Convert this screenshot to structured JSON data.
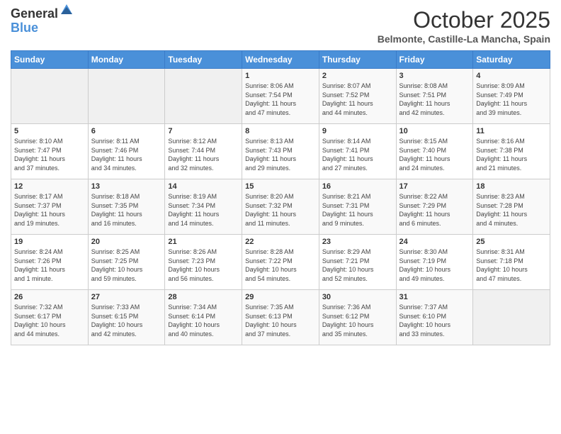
{
  "logo": {
    "general": "General",
    "blue": "Blue"
  },
  "title": "October 2025",
  "location": "Belmonte, Castille-La Mancha, Spain",
  "headers": [
    "Sunday",
    "Monday",
    "Tuesday",
    "Wednesday",
    "Thursday",
    "Friday",
    "Saturday"
  ],
  "weeks": [
    [
      {
        "day": "",
        "info": ""
      },
      {
        "day": "",
        "info": ""
      },
      {
        "day": "",
        "info": ""
      },
      {
        "day": "1",
        "info": "Sunrise: 8:06 AM\nSunset: 7:54 PM\nDaylight: 11 hours\nand 47 minutes."
      },
      {
        "day": "2",
        "info": "Sunrise: 8:07 AM\nSunset: 7:52 PM\nDaylight: 11 hours\nand 44 minutes."
      },
      {
        "day": "3",
        "info": "Sunrise: 8:08 AM\nSunset: 7:51 PM\nDaylight: 11 hours\nand 42 minutes."
      },
      {
        "day": "4",
        "info": "Sunrise: 8:09 AM\nSunset: 7:49 PM\nDaylight: 11 hours\nand 39 minutes."
      }
    ],
    [
      {
        "day": "5",
        "info": "Sunrise: 8:10 AM\nSunset: 7:47 PM\nDaylight: 11 hours\nand 37 minutes."
      },
      {
        "day": "6",
        "info": "Sunrise: 8:11 AM\nSunset: 7:46 PM\nDaylight: 11 hours\nand 34 minutes."
      },
      {
        "day": "7",
        "info": "Sunrise: 8:12 AM\nSunset: 7:44 PM\nDaylight: 11 hours\nand 32 minutes."
      },
      {
        "day": "8",
        "info": "Sunrise: 8:13 AM\nSunset: 7:43 PM\nDaylight: 11 hours\nand 29 minutes."
      },
      {
        "day": "9",
        "info": "Sunrise: 8:14 AM\nSunset: 7:41 PM\nDaylight: 11 hours\nand 27 minutes."
      },
      {
        "day": "10",
        "info": "Sunrise: 8:15 AM\nSunset: 7:40 PM\nDaylight: 11 hours\nand 24 minutes."
      },
      {
        "day": "11",
        "info": "Sunrise: 8:16 AM\nSunset: 7:38 PM\nDaylight: 11 hours\nand 21 minutes."
      }
    ],
    [
      {
        "day": "12",
        "info": "Sunrise: 8:17 AM\nSunset: 7:37 PM\nDaylight: 11 hours\nand 19 minutes."
      },
      {
        "day": "13",
        "info": "Sunrise: 8:18 AM\nSunset: 7:35 PM\nDaylight: 11 hours\nand 16 minutes."
      },
      {
        "day": "14",
        "info": "Sunrise: 8:19 AM\nSunset: 7:34 PM\nDaylight: 11 hours\nand 14 minutes."
      },
      {
        "day": "15",
        "info": "Sunrise: 8:20 AM\nSunset: 7:32 PM\nDaylight: 11 hours\nand 11 minutes."
      },
      {
        "day": "16",
        "info": "Sunrise: 8:21 AM\nSunset: 7:31 PM\nDaylight: 11 hours\nand 9 minutes."
      },
      {
        "day": "17",
        "info": "Sunrise: 8:22 AM\nSunset: 7:29 PM\nDaylight: 11 hours\nand 6 minutes."
      },
      {
        "day": "18",
        "info": "Sunrise: 8:23 AM\nSunset: 7:28 PM\nDaylight: 11 hours\nand 4 minutes."
      }
    ],
    [
      {
        "day": "19",
        "info": "Sunrise: 8:24 AM\nSunset: 7:26 PM\nDaylight: 11 hours\nand 1 minute."
      },
      {
        "day": "20",
        "info": "Sunrise: 8:25 AM\nSunset: 7:25 PM\nDaylight: 10 hours\nand 59 minutes."
      },
      {
        "day": "21",
        "info": "Sunrise: 8:26 AM\nSunset: 7:23 PM\nDaylight: 10 hours\nand 56 minutes."
      },
      {
        "day": "22",
        "info": "Sunrise: 8:28 AM\nSunset: 7:22 PM\nDaylight: 10 hours\nand 54 minutes."
      },
      {
        "day": "23",
        "info": "Sunrise: 8:29 AM\nSunset: 7:21 PM\nDaylight: 10 hours\nand 52 minutes."
      },
      {
        "day": "24",
        "info": "Sunrise: 8:30 AM\nSunset: 7:19 PM\nDaylight: 10 hours\nand 49 minutes."
      },
      {
        "day": "25",
        "info": "Sunrise: 8:31 AM\nSunset: 7:18 PM\nDaylight: 10 hours\nand 47 minutes."
      }
    ],
    [
      {
        "day": "26",
        "info": "Sunrise: 7:32 AM\nSunset: 6:17 PM\nDaylight: 10 hours\nand 44 minutes."
      },
      {
        "day": "27",
        "info": "Sunrise: 7:33 AM\nSunset: 6:15 PM\nDaylight: 10 hours\nand 42 minutes."
      },
      {
        "day": "28",
        "info": "Sunrise: 7:34 AM\nSunset: 6:14 PM\nDaylight: 10 hours\nand 40 minutes."
      },
      {
        "day": "29",
        "info": "Sunrise: 7:35 AM\nSunset: 6:13 PM\nDaylight: 10 hours\nand 37 minutes."
      },
      {
        "day": "30",
        "info": "Sunrise: 7:36 AM\nSunset: 6:12 PM\nDaylight: 10 hours\nand 35 minutes."
      },
      {
        "day": "31",
        "info": "Sunrise: 7:37 AM\nSunset: 6:10 PM\nDaylight: 10 hours\nand 33 minutes."
      },
      {
        "day": "",
        "info": ""
      }
    ]
  ]
}
